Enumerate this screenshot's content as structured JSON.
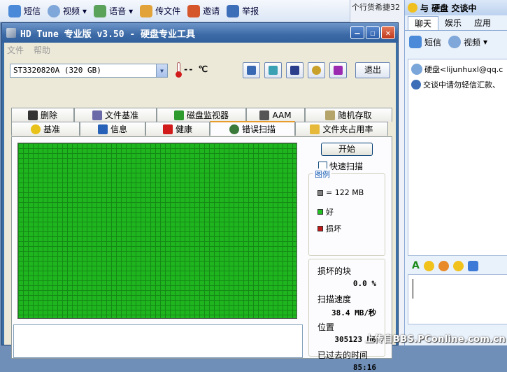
{
  "background_window": {
    "toolbar": [
      "短信",
      "视频",
      "语音",
      "传文件",
      "邀请",
      "举报"
    ],
    "side_text": "个行货希捷32"
  },
  "hdtune": {
    "title": "HD Tune 专业版 v3.50 - 硬盘专业工具",
    "menu": [
      "文件",
      "帮助"
    ],
    "drive": "ST3320820A (320 GB)",
    "temperature": "-- ℃",
    "exit_label": "退出",
    "tabs_row1": [
      {
        "label": "删除",
        "icon": "trash-icon"
      },
      {
        "label": "文件基准",
        "icon": "file-benchmark-icon"
      },
      {
        "label": "磁盘监视器",
        "icon": "monitor-chart-icon"
      },
      {
        "label": "AAM",
        "icon": "speaker-icon"
      },
      {
        "label": "随机存取",
        "icon": "random-access-icon"
      }
    ],
    "tabs_row2": [
      {
        "label": "基准",
        "icon": "bulb-icon"
      },
      {
        "label": "信息",
        "icon": "info-icon"
      },
      {
        "label": "健康",
        "icon": "health-cross-icon"
      },
      {
        "label": "错误扫描",
        "icon": "magnifier-icon",
        "active": true
      },
      {
        "label": "文件夹占用率",
        "icon": "folder-icon"
      }
    ],
    "scan": {
      "start_label": "开始",
      "quick_scan_label": "快速扫描",
      "quick_scan_checked": false,
      "legend_title": "图例",
      "legend": [
        {
          "label": "= 122 MB",
          "color": "#808080"
        },
        {
          "label": "好",
          "color": "#22c022"
        },
        {
          "label": "损坏",
          "color": "#c01818"
        }
      ],
      "damaged_blocks_label": "损坏的块",
      "damaged_blocks_value": "0.0 %",
      "scan_speed_label": "扫描速度",
      "scan_speed_value": "38.4 MB/秒",
      "position_label": "位置",
      "position_value": "305123 MB",
      "elapsed_label": "已过去的时间",
      "elapsed_value": "85:16",
      "grid_color": "#22c022"
    }
  },
  "qq": {
    "title": "与 硬盘 交谈中",
    "tabs": [
      "聊天",
      "娱乐",
      "应用"
    ],
    "tools": [
      "短信",
      "视频"
    ],
    "messages": [
      {
        "icon": "user-avatar-icon",
        "text": "硬盘<lijunhuxl@qq.c"
      },
      {
        "icon": "info-icon",
        "text": "交谈中请勿轻信汇款、"
      }
    ]
  },
  "watermark": "上传自BBS.PConline.com.cn"
}
